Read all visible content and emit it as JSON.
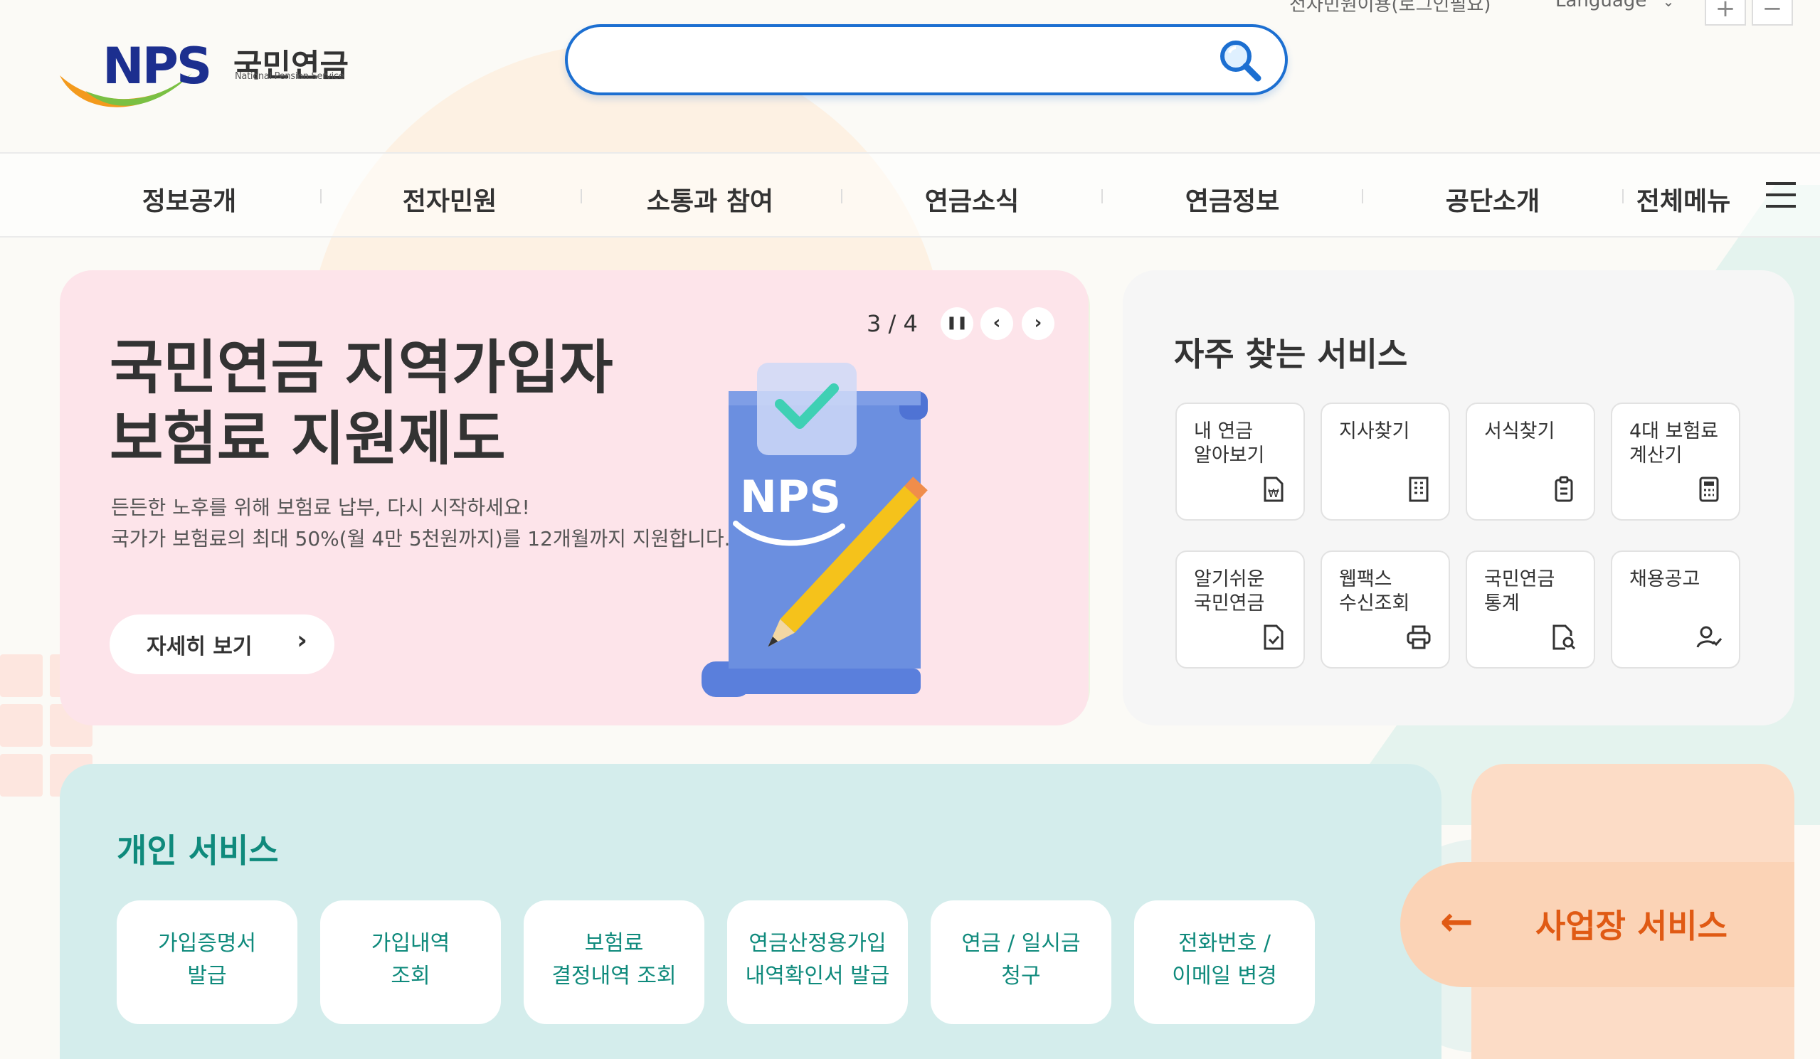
{
  "header": {
    "logo": {
      "mark": "NPS",
      "name_ko": "국민연금",
      "name_en": "National Pension Service"
    },
    "search": {
      "placeholder": "",
      "button_icon": "search-icon"
    },
    "util_links": {
      "login_note": "전자민원이용(로그인필요)",
      "language": "Language"
    },
    "font_size": {
      "increase": "+",
      "decrease": "−"
    }
  },
  "gnb": {
    "items": [
      "정보공개",
      "전자민원",
      "소통과 참여",
      "연금소식",
      "연금정보",
      "공단소개"
    ],
    "all_menu": "전체메뉴"
  },
  "banner": {
    "title_line1": "국민연금 지역가입자",
    "title_line2": "보험료 지원제도",
    "desc_line1": "든든한 노후를 위해 보험료 납부, 다시 시작하세요!",
    "desc_line2": "국가가 보험료의 최대 50%(월 4만 5천원까지)를 12개월까지 지원합니다.",
    "more_label": "자세히 보기",
    "counter": "3 / 4",
    "illustration_text": "NPS",
    "colors": {
      "background": "#fde4ea",
      "document": "#6b8fe0",
      "check": "#3fd0b4"
    }
  },
  "frequent": {
    "title": "자주 찾는 서비스",
    "tiles": [
      {
        "label": "내 연금\n알아보기",
        "icon": "won-document-icon"
      },
      {
        "label": "지사찾기",
        "icon": "building-icon"
      },
      {
        "label": "서식찾기",
        "icon": "clipboard-icon"
      },
      {
        "label": "4대 보험료\n계산기",
        "icon": "calculator-icon"
      },
      {
        "label": "알기쉬운\n국민연금",
        "icon": "document-check-icon"
      },
      {
        "label": "웹팩스\n수신조회",
        "icon": "printer-icon"
      },
      {
        "label": "국민연금\n통계",
        "icon": "document-search-icon"
      },
      {
        "label": "채용공고",
        "icon": "person-check-icon"
      }
    ]
  },
  "personal": {
    "title": "개인 서비스",
    "buttons": [
      {
        "line1": "가입증명서",
        "line2": "발급"
      },
      {
        "line1": "가입내역",
        "line2": "조회"
      },
      {
        "line1": "보험료",
        "line2": "결정내역 조회"
      },
      {
        "line1": "연금산정용가입",
        "line2": "내역확인서 발급"
      },
      {
        "line1": "연금 / 일시금",
        "line2": "청구"
      },
      {
        "line1": "전화번호 /",
        "line2": "이메일 변경"
      }
    ]
  },
  "business": {
    "label": "사업장 서비스",
    "arrow": "←"
  },
  "colors": {
    "brand_blue": "#1c2f8f",
    "search_blue": "#1c6fd1",
    "teal": "#0f8a7c",
    "orange": "#e05a14"
  }
}
